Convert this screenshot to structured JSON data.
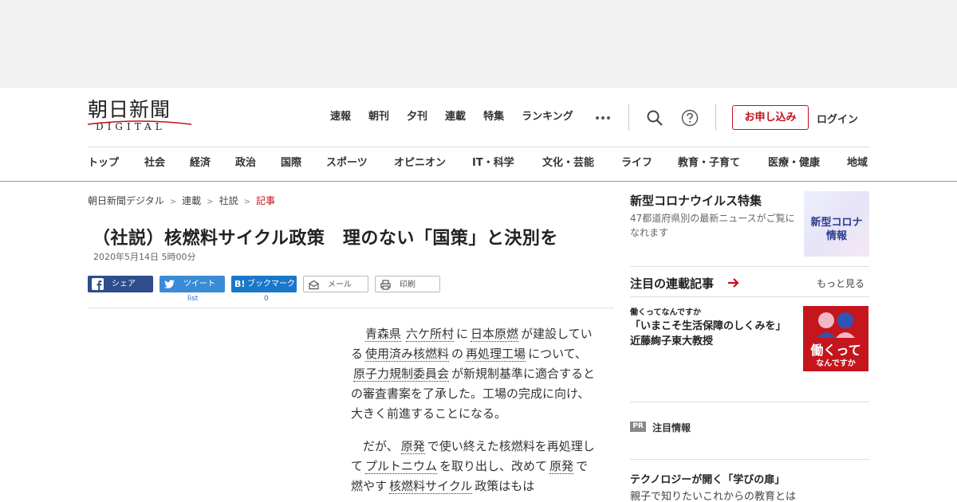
{
  "header": {
    "logo_kanji": "朝日新聞",
    "logo_sub": "DIGITAL",
    "nav": [
      "速報",
      "朝刊",
      "夕刊",
      "連載",
      "特集",
      "ランキング"
    ],
    "apply_label": "お申し込み",
    "login_label": "ログイン",
    "accent_color": "#c4101b"
  },
  "categories": [
    "トップ",
    "社会",
    "経済",
    "政治",
    "国際",
    "スポーツ",
    "オピニオン",
    "IT・科学",
    "文化・芸能",
    "ライフ",
    "教育・子育て",
    "医療・健康",
    "地域"
  ],
  "breadcrumb": [
    "朝日新聞デジタル",
    "連載",
    "社説",
    "記事"
  ],
  "article": {
    "title": "（社説）核燃料サイクル政策　理のない「国策」と決別を",
    "date": "2020年5月14日 5時00分",
    "share": {
      "facebook": "シェア",
      "twitter": "ツイート",
      "hatena": "ブックマーク",
      "mail": "メール",
      "print": "印刷",
      "twitter_count": "list",
      "hatena_count": "0"
    },
    "p1": [
      "青森県",
      "六ケ所村",
      "に",
      "日本原燃",
      "が建設している",
      "使用済み核燃料",
      "の",
      "再処理工場",
      "について、",
      "原子力規制委員会",
      "が新規制基準に適合するとの審査書案を了承した。工場の完成に向け、大きく前進することになる。"
    ],
    "p2": [
      "だが、",
      "原発",
      "で使い終えた核燃料を再処理して",
      "プルトニウム",
      "を取り出し、改めて",
      "原発",
      "で燃やす",
      "核燃料サイクル",
      "政策はもは"
    ]
  },
  "sidebar": {
    "corona_title": "新型コロナウイルス特集",
    "corona_desc": "47都道府県別の最新ニュースがご覧になれます",
    "corona_img_line1": "新型コロナ",
    "corona_img_line2": "情報",
    "series_title": "注目の連載記事",
    "more": "もっと見る",
    "series_kicker": "働くってなんですか",
    "series_body": "「いまこそ生活保障のしくみを」　近藤絢子東大教授",
    "series_img_line1": "働くって",
    "series_img_line2": "なんですか",
    "pr_badge": "PR",
    "pr_label": "注目情報",
    "tech_title": "テクノロジーが開く「学びの扉」",
    "tech_desc": "親子で知りたいこれからの教育とは"
  }
}
